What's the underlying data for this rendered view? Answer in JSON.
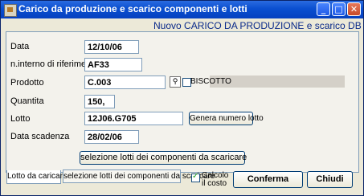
{
  "window": {
    "title": "Carico da produzione e scarico componenti e lotti",
    "subtitle": "Nuovo CARICO DA PRODUZIONE e scarico DB",
    "minimize_glyph": "_",
    "maximize_glyph": "□",
    "close_glyph": "✕",
    "icon": "app-icon"
  },
  "form": {
    "data": {
      "label": "Data",
      "value": "12/10/06"
    },
    "riferimento": {
      "label": "n.interno di riferimento",
      "value": "AF33"
    },
    "prodotto": {
      "label": "Prodotto",
      "value": "C.003",
      "description": "BISCOTTO",
      "search_icon": "binoculars-icon",
      "search_glyph": "⚲"
    },
    "quantita": {
      "label": "Quantita",
      "value": "150,"
    },
    "lotto": {
      "label": "Lotto",
      "value": "12J06.G705",
      "generate_button": "Genera numero lotto"
    },
    "scadenza": {
      "label": "Data scadenza",
      "value": "28/02/06"
    },
    "select_lots_button": "selezione lotti dei componenti da scaricare"
  },
  "tabs": [
    {
      "label": "Lotto da caricare",
      "active": true
    },
    {
      "label": "selezione lotti dei componenti da scaricare",
      "active": false
    }
  ],
  "footer": {
    "calcolo_label_line1": "Calcolo",
    "calcolo_label_line2": "il costo",
    "calcolo_checked": true,
    "confirm_button": "Conferma",
    "close_button": "Chiudi"
  },
  "colors": {
    "titlebar": "#0a4fd0",
    "subtitle": "#0a2a8a",
    "window_bg": "#ece9d8"
  }
}
